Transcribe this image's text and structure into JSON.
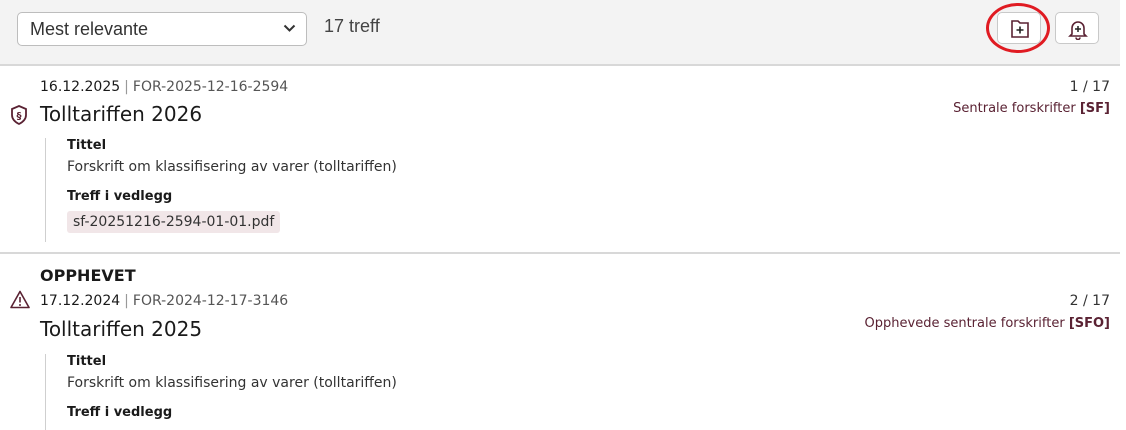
{
  "toolbar": {
    "sort_value": "Mest relevante",
    "hit_count": "17 treff",
    "save_search_icon": "folder-plus-icon",
    "alert_icon": "bell-plus-icon"
  },
  "results": [
    {
      "date": "16.12.2025",
      "id": "FOR-2025-12-16-2594",
      "title": "Tolltariffen 2026",
      "icon": "paragraph-shield-icon",
      "position": "1 / 17",
      "source_name": "Sentrale forskrifter",
      "source_code": "[SF]",
      "field_label": "Tittel",
      "field_value": "Forskrift om klassifisering av varer (tolltariffen)",
      "attachment_label": "Treff i vedlegg",
      "attachment_file": "sf-20251216-2594-01-01.pdf"
    },
    {
      "status": "OPPHEVET",
      "date": "17.12.2024",
      "id": "FOR-2024-12-17-3146",
      "title": "Tolltariffen 2025",
      "icon": "warning-triangle-icon",
      "position": "2 / 17",
      "source_name": "Opphevede sentrale forskrifter",
      "source_code": "[SFO]",
      "field_label": "Tittel",
      "field_value": "Forskrift om klassifisering av varer (tolltariffen)",
      "attachment_label": "Treff i vedlegg"
    }
  ],
  "colors": {
    "accent": "#5a2233",
    "annotation": "#e01b22"
  }
}
